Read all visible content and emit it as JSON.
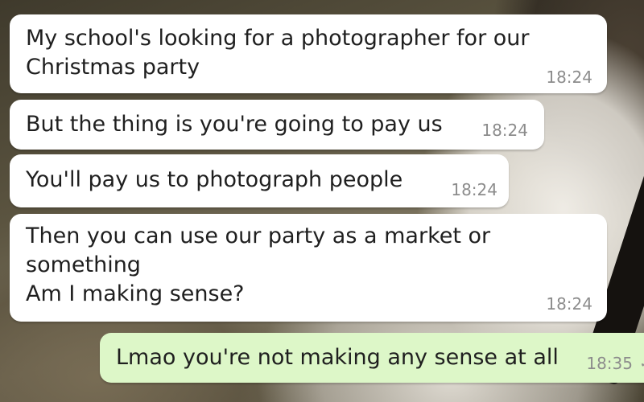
{
  "messages": [
    {
      "id": "b1",
      "direction": "incoming",
      "lines": [
        "My school's looking for a photographer for our",
        "Christmas party"
      ],
      "time": "18:24"
    },
    {
      "id": "b2",
      "direction": "incoming",
      "lines": [
        "But the thing is you're going to pay us"
      ],
      "time": "18:24"
    },
    {
      "id": "b3",
      "direction": "incoming",
      "lines": [
        "You'll pay us to photograph people"
      ],
      "time": "18:24"
    },
    {
      "id": "b4",
      "direction": "incoming",
      "lines": [
        "Then you can use our party as a market or",
        "something",
        "Am I making sense?"
      ],
      "time": "18:24"
    },
    {
      "id": "b5",
      "direction": "outgoing",
      "lines": [
        "Lmao you're not making any sense at all"
      ],
      "time": "18:35",
      "status_icon": "delivered-check-icon"
    }
  ],
  "colors": {
    "incoming_bubble": "#ffffff",
    "outgoing_bubble": "#ddf7c8",
    "timestamp": "#8c8c8c",
    "message_text": "#1f1f1f"
  }
}
